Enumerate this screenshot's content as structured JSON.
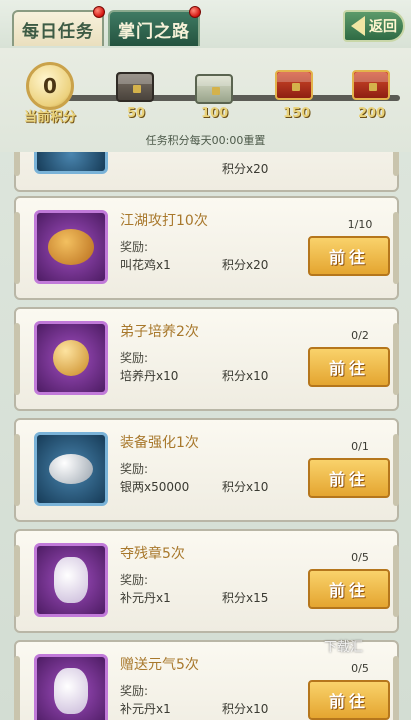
{
  "tabs": [
    {
      "label": "每日任务"
    },
    {
      "label": "掌门之路"
    }
  ],
  "back_label": "返回",
  "progress": {
    "current_score": "0",
    "current_label": "当前积分",
    "milestones": [
      "50",
      "100",
      "150",
      "200"
    ],
    "reset_note": "任务积分每天00:00重置"
  },
  "reward_heading": "奖励:",
  "go_label": "前往",
  "tasks": [
    {
      "title": "",
      "count": "",
      "reward_item": "",
      "reward_points": "积分x20"
    },
    {
      "title": "江湖攻打10次",
      "count": "1/10",
      "reward_item": "叫花鸡x1",
      "reward_points": "积分x20"
    },
    {
      "title": "弟子培养2次",
      "count": "0/2",
      "reward_item": "培养丹x10",
      "reward_points": "积分x10"
    },
    {
      "title": "装备强化1次",
      "count": "0/1",
      "reward_item": "银两x50000",
      "reward_points": "积分x10"
    },
    {
      "title": "夺残章5次",
      "count": "0/5",
      "reward_item": "补元丹x1",
      "reward_points": "积分x15"
    },
    {
      "title": "赠送元气5次",
      "count": "0/5",
      "reward_item": "补元丹x1",
      "reward_points": "积分x10"
    }
  ],
  "watermark": "下载汇"
}
